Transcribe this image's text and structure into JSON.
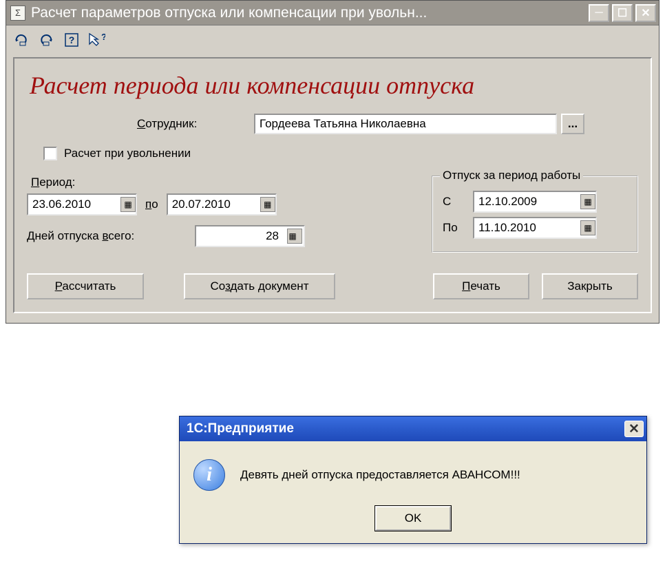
{
  "window": {
    "title": "Расчет параметров отпуска или компенсации при увольн..."
  },
  "heading": "Расчет периода или компенсации отпуска",
  "employee": {
    "label": "Сотрудник:",
    "value": "Гордеева Татьяна Николаевна"
  },
  "dismissal_checkbox_label": "Расчет при увольнении",
  "period": {
    "label": "Период:",
    "from": "23.06.2010",
    "to_label": "по",
    "to": "20.07.2010"
  },
  "days": {
    "label": "Дней отпуска всего:",
    "value": "28"
  },
  "work_period": {
    "legend": "Отпуск за период работы",
    "from_label": "С",
    "from": "12.10.2009",
    "to_label": "По",
    "to": "11.10.2010"
  },
  "buttons": {
    "calculate": "Рассчитать",
    "create_doc": "Создать документ",
    "print": "Печать",
    "close": "Закрыть"
  },
  "dialog": {
    "title": "1С:Предприятие",
    "message": "Девять дней отпуска предоставляется АВАНСОМ!!!",
    "ok": "OK"
  }
}
